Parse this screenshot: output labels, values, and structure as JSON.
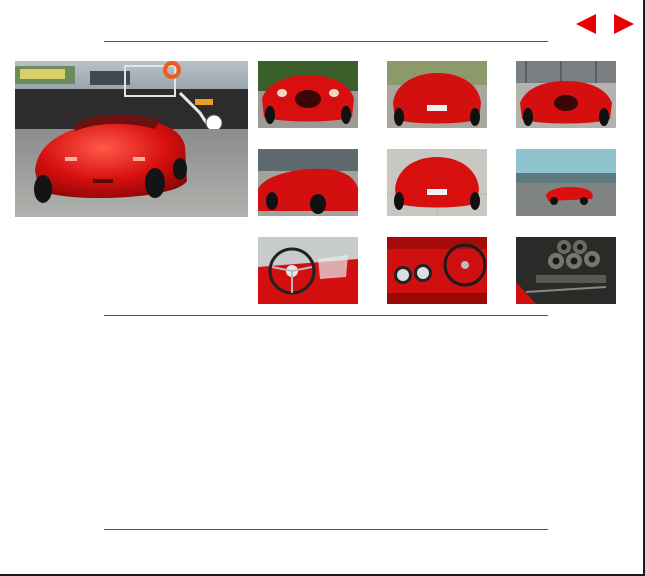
{
  "navigation": {
    "prev_icon": "triangle-left-icon",
    "next_icon": "triangle-right-icon",
    "arrow_color": "#e60000"
  },
  "gallery": {
    "main_photo": "red-roadster-rear-harbor-photo",
    "thumbnails": [
      "red-roadster-front-trees-thumb",
      "red-roadster-rear-thumb",
      "red-roadster-front-parking-thumb",
      "red-roadster-rear-quarter-thumb",
      "red-roadster-rear-plain-thumb",
      "red-roadster-motion-thumb",
      "steering-wheel-interior-thumb",
      "dashboard-gauges-thumb",
      "engine-carburetors-thumb"
    ]
  },
  "colors": {
    "rule": "#2f5f7c",
    "car_red": "#d90d10"
  }
}
